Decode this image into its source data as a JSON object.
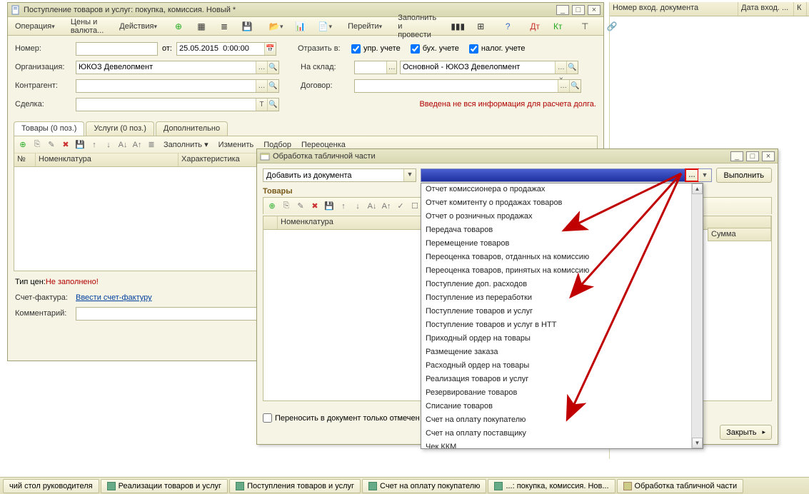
{
  "main_window": {
    "title": "Поступление товаров и услуг: покупка, комиссия. Новый *",
    "toolbar": {
      "operation": "Операция",
      "prices": "Цены и валюта...",
      "actions": "Действия",
      "goto": "Перейти",
      "fill_post": "Заполнить и провести"
    },
    "form": {
      "number_lbl": "Номер:",
      "from_lbl": "от:",
      "date": "25.05.2015  0:00:00",
      "reflect_lbl": "Отразить в:",
      "chk_upr": "упр. учете",
      "chk_buh": "бух. учете",
      "chk_nal": "налог. учете",
      "org_lbl": "Организация:",
      "org_val": "ЮКОЗ Девелопмент",
      "warehouse_lbl": "На склад:",
      "warehouse_val": "Основной - ЮКОЗ Девелопмент",
      "counterparty_lbl": "Контрагент:",
      "contract_lbl": "Договор:",
      "deal_lbl": "Сделка:",
      "debt_info": "Введена не вся информация для расчета долга."
    },
    "tabs": {
      "goods": "Товары (0 поз.)",
      "services": "Услуги (0 поз.)",
      "extra": "Дополнительно"
    },
    "tab_toolbar": {
      "fill": "Заполнить",
      "change": "Изменить",
      "select": "Подбор",
      "revalue": "Переоценка"
    },
    "table": {
      "col_n": "№",
      "col_nom": "Номенклатура",
      "col_char": "Характеристика"
    },
    "footer": {
      "price_type_lbl": "Тип цен: ",
      "price_type_val": "Не заполнено!",
      "invoice_lbl": "Счет-фактура:",
      "invoice_link": "Ввести счет-фактуру",
      "comment_lbl": "Комментарий:"
    }
  },
  "right": {
    "col1": "Номер вход. документа",
    "col2": "Дата вход. ...",
    "col3": "К"
  },
  "modal": {
    "title": "Обработка табличной части",
    "add_from": "Добавить из документа",
    "run": "Выполнить",
    "sect": "Товары",
    "col_nom": "Номенклатура",
    "col_sum": "Сумма",
    "transfer_chk": "Переносить в документ только отмечен",
    "close": "Закрыть"
  },
  "dropdown": [
    "Отчет комиссионера о продажах",
    "Отчет комитенту о продажах товаров",
    "Отчет о розничных продажах",
    "Передача товаров",
    "Перемещение товаров",
    "Переоценка товаров, отданных на комиссию",
    "Переоценка товаров, принятых на комиссию",
    "Поступление доп. расходов",
    "Поступление из переработки",
    "Поступление товаров и услуг",
    "Поступление товаров и услуг в НТТ",
    "Приходный ордер на товары",
    "Размещение заказа",
    "Расходный ордер на товары",
    "Реализация товаров и услуг",
    "Резервирование товаров",
    "Списание товаров",
    "Счет на оплату покупателю",
    "Счет на оплату поставщику",
    "Чек ККМ"
  ],
  "taskbar": {
    "t0": "чий стол руководителя",
    "t1": "Реализации товаров и услуг",
    "t2": "Поступления товаров и услуг",
    "t3": "Счет на оплату покупателю",
    "t4": "...: покупка, комиссия. Нов...",
    "t5": "Обработка табличной части"
  }
}
